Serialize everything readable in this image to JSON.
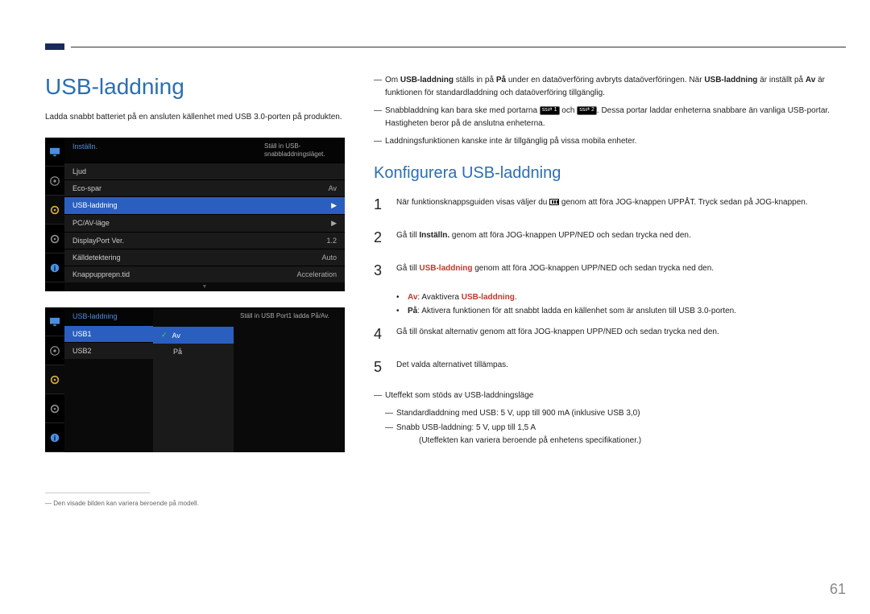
{
  "header": {
    "title": "USB-laddning",
    "intro": "Ladda snabbt batteriet på en ansluten källenhet med USB 3.0-porten på produkten."
  },
  "notes_right": {
    "n1_pre": "Om ",
    "n1_b1": "USB-laddning",
    "n1_mid1": " ställs in på ",
    "n1_b2": "På",
    "n1_mid2": " under en dataöverföring avbryts dataöverföringen. När ",
    "n1_b3": "USB-laddning",
    "n1_mid3": " är inställt på ",
    "n1_b4": "Av",
    "n1_post": " är funktionen för standardladdning och dataöverföring tillgänglig.",
    "n2_pre": "Snabbladdning kan bara ske med portarna ",
    "n2_badge1": "ss⇄ 1",
    "n2_mid": " och ",
    "n2_badge2": "ss⇄ 2",
    "n2_post": ". Dessa portar laddar enheterna snabbare än vanliga USB-portar. Hastigheten beror på de anslutna enheterna.",
    "n3": "Laddningsfunktionen kanske inte är tillgänglig på vissa mobila enheter."
  },
  "osd1": {
    "title": "Inställn.",
    "hint": "Ställ in USB-snabbladdningsläget.",
    "rows": [
      {
        "label": "Ljud",
        "val": ""
      },
      {
        "label": "Eco-spar",
        "val": "Av"
      },
      {
        "label": "USB-laddning",
        "val": "▶",
        "sel": true
      },
      {
        "label": "PC/AV-läge",
        "val": "▶"
      },
      {
        "label": "DisplayPort Ver.",
        "val": "1.2"
      },
      {
        "label": "Källdetektering",
        "val": "Auto"
      },
      {
        "label": "Knappupprepn.tid",
        "val": "Acceleration"
      }
    ]
  },
  "osd2": {
    "title": "USB-laddning",
    "hint": "Ställ in USB Port1 ladda På/Av.",
    "rows": [
      {
        "label": "USB1",
        "sel": true
      },
      {
        "label": "USB2"
      }
    ],
    "popup": [
      {
        "label": "Av",
        "sel": true,
        "check": true
      },
      {
        "label": "På"
      }
    ]
  },
  "footnote": "Den visade bilden kan variera beroende på modell.",
  "section2": {
    "title": "Konfigurera USB-laddning",
    "steps": {
      "s1_pre": "När funktionsknappsguiden visas väljer du ",
      "s1_post": " genom att föra JOG-knappen UPPÅT. Tryck sedan på JOG-knappen.",
      "s2_pre": "Gå till ",
      "s2_b": "Inställn.",
      "s2_post": " genom att föra JOG-knappen UPP/NED och sedan trycka ned den.",
      "s3_pre": "Gå till ",
      "s3_b": "USB-laddning",
      "s3_post": " genom att föra JOG-knappen UPP/NED och sedan trycka ned den.",
      "bullet_av_b": "Av",
      "bullet_av_mid": ": Avaktivera ",
      "bullet_av_b2": "USB-laddning",
      "bullet_av_post": ".",
      "bullet_pa_b": "På",
      "bullet_pa_post": ": Aktivera funktionen för att snabbt ladda en källenhet som är ansluten till USB 3.0-porten.",
      "s4": "Gå till önskat alternativ genom att föra JOG-knappen UPP/NED och sedan trycka ned den.",
      "s5": "Det valda alternativet tillämpas."
    },
    "tail_notes": {
      "t1": "Uteffekt som stöds av USB-laddningsläge",
      "t2": "Standardladdning med USB: 5 V, upp till 900 mA (inklusive USB 3,0)",
      "t3a": "Snabb USB-laddning: 5 V, upp till 1,5 A",
      "t3b": "(Uteffekten kan variera beroende på enhetens specifikationer.)"
    }
  },
  "nums": {
    "n1": "1",
    "n2": "2",
    "n3": "3",
    "n4": "4",
    "n5": "5"
  },
  "page_number": "61"
}
